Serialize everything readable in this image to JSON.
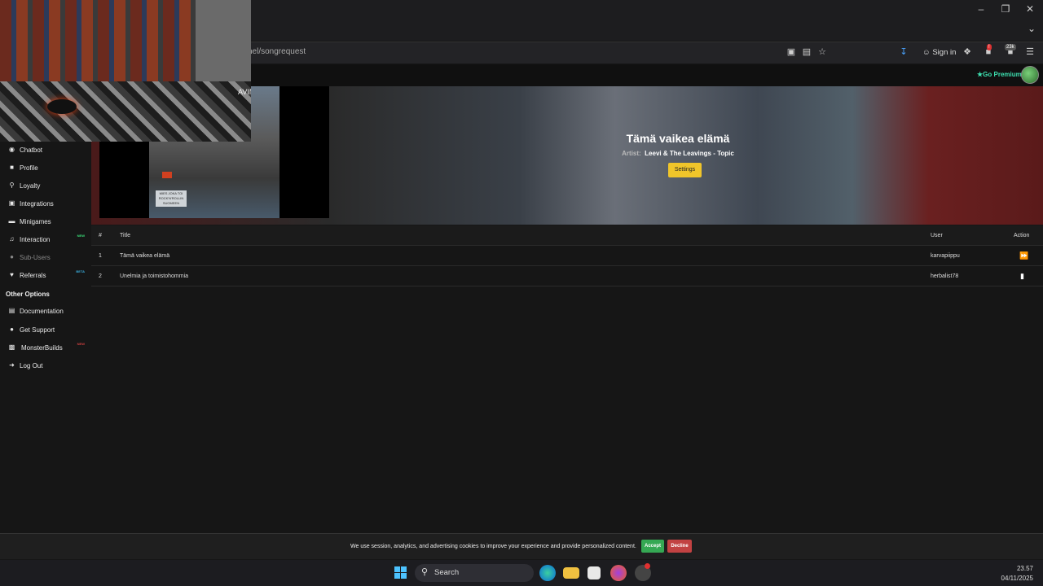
{
  "browser": {
    "url_fragment": "nel/songrequest",
    "sign_in_label": "Sign in",
    "extension_badge_count": "23k"
  },
  "site_header": {
    "go_premium_label": "Go Premium"
  },
  "webcam": {
    "visible_overlay_text": "AVINGS"
  },
  "sidebar": {
    "items": [
      {
        "label": "Chatbot",
        "icon": "robot-icon",
        "tag": ""
      },
      {
        "label": "Profile",
        "icon": "user-icon",
        "tag": ""
      },
      {
        "label": "Loyalty",
        "icon": "trophy-icon",
        "tag": ""
      },
      {
        "label": "Integrations",
        "icon": "plug-icon",
        "tag": ""
      },
      {
        "label": "Minigames",
        "icon": "gamepad-icon",
        "tag": ""
      },
      {
        "label": "Interaction",
        "icon": "music-icon",
        "tag": "NEW"
      },
      {
        "label": "Sub-Users",
        "icon": "users-icon",
        "tag": ""
      },
      {
        "label": "Referrals",
        "icon": "handshake-icon",
        "tag": "BETA"
      }
    ],
    "other_options_title": "Other Options",
    "other_items": [
      {
        "label": "Documentation",
        "icon": "book-icon",
        "tag": ""
      },
      {
        "label": "Get Support",
        "icon": "question-icon",
        "tag": ""
      },
      {
        "label": "MonsterBuilds",
        "icon": "laptop-icon",
        "tag": "NEW"
      },
      {
        "label": "Log Out",
        "icon": "logout-icon",
        "tag": ""
      }
    ],
    "colors": {
      "new_tag": "#3be07a",
      "beta_tag": "#3ab0e0",
      "hot_tag": "#d04040"
    }
  },
  "player": {
    "album_art_text": "MIES JOKA TOI ROCK'N'ROLLIN SUOMEEN",
    "now_playing_title": "Tämä vaikea elämä",
    "artist_label": "Artist:",
    "artist_name": "Leevi & The Leavings - Topic",
    "settings_label": "Settings",
    "accent_color": "#f0c52a"
  },
  "queue": {
    "headers": {
      "num": "#",
      "title": "Title",
      "user": "User",
      "action": "Action"
    },
    "rows": [
      {
        "num": "1",
        "title": "Tämä vaikea elämä",
        "user": "karvapiippu",
        "action_icon": "fast-forward-icon"
      },
      {
        "num": "2",
        "title": "Unelmia ja toimistohommia",
        "user": "herbalist78",
        "action_icon": "trash-icon"
      }
    ]
  },
  "cookie_bar": {
    "text": "We use session, analytics, and advertising cookies to improve your experience and provide personalized content.",
    "accept_label": "Accept",
    "decline_label": "Decline"
  },
  "taskbar": {
    "search_label": "Search",
    "time": "23.57",
    "date": "04/11/2025"
  }
}
